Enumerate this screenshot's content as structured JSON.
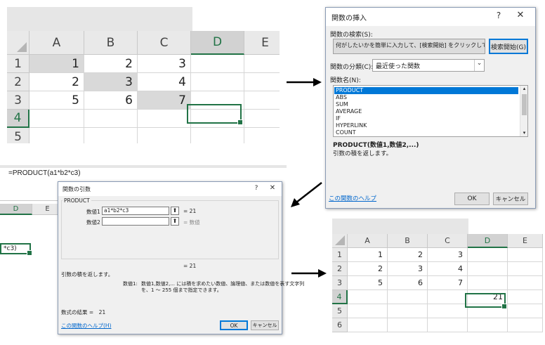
{
  "sheet1": {
    "columns": [
      "A",
      "B",
      "C",
      "D",
      "E"
    ],
    "rows": [
      "1",
      "2",
      "3",
      "4",
      "5"
    ],
    "cells": [
      [
        "1",
        "2",
        "3",
        ""
      ],
      [
        "2",
        "3",
        "4",
        ""
      ],
      [
        "5",
        "6",
        "7",
        ""
      ],
      [
        "",
        "",
        "",
        ""
      ],
      [
        "",
        "",
        "",
        ""
      ]
    ]
  },
  "insert_dialog": {
    "title": "関数の挿入",
    "help_btn": "?",
    "close_btn": "✕",
    "search_label": "関数の検索(S):",
    "search_text": "何がしたいかを簡単に入力して、[検索開始] をクリックしてください。",
    "search_button": "検索開始(G)",
    "category_label": "関数の分類(C):",
    "category_value": "最近使った関数",
    "name_label": "関数名(N):",
    "functions": [
      "PRODUCT",
      "ABS",
      "SUM",
      "AVERAGE",
      "IF",
      "HYPERLINK",
      "COUNT"
    ],
    "syntax": "PRODUCT(数値1,数値2,...)",
    "description": "引数の積を返します。",
    "help_link": "この関数のヘルプ",
    "ok": "OK",
    "cancel": "キャンセル"
  },
  "formula_bar": {
    "formula": "=PRODUCT(a1*b2*c3)",
    "col_d": "D",
    "col_e": "E",
    "cell_tail": "*c3)"
  },
  "args_dialog": {
    "title": "関数の引数",
    "help_btn": "?",
    "close_btn": "✕",
    "func_name": "PRODUCT",
    "arg1_label": "数値1",
    "arg1_value": "a1*b2*c3",
    "arg1_result": "= 21",
    "arg2_label": "数値2",
    "arg2_value": "",
    "arg2_result": "= 数値",
    "total": "= 21",
    "description": "引数の積を返します。",
    "arg_desc_name": "数値1:",
    "arg_desc_line1": "数値1,数値2,... には積を求めたい数値、論理値、または数値を表す文字列",
    "arg_desc_line2": "を、1 ～ 255 個まで指定できます。",
    "result_line": "数式の結果 =　21",
    "help_link": "この関数のヘルプ(H)",
    "ok": "OK",
    "cancel": "キャンセル"
  },
  "sheet2": {
    "columns": [
      "A",
      "B",
      "C",
      "D",
      "E"
    ],
    "rows": [
      "1",
      "2",
      "3",
      "4",
      "5",
      "6"
    ],
    "cells": [
      [
        "1",
        "2",
        "3",
        ""
      ],
      [
        "2",
        "3",
        "4",
        ""
      ],
      [
        "5",
        "6",
        "7",
        ""
      ],
      [
        "",
        "",
        "",
        "21"
      ],
      [
        "",
        "",
        "",
        ""
      ],
      [
        "",
        "",
        "",
        ""
      ]
    ]
  },
  "colors": {
    "excel_green": "#217346",
    "selection_blue": "#0078d7",
    "link_blue": "#0066cc"
  }
}
